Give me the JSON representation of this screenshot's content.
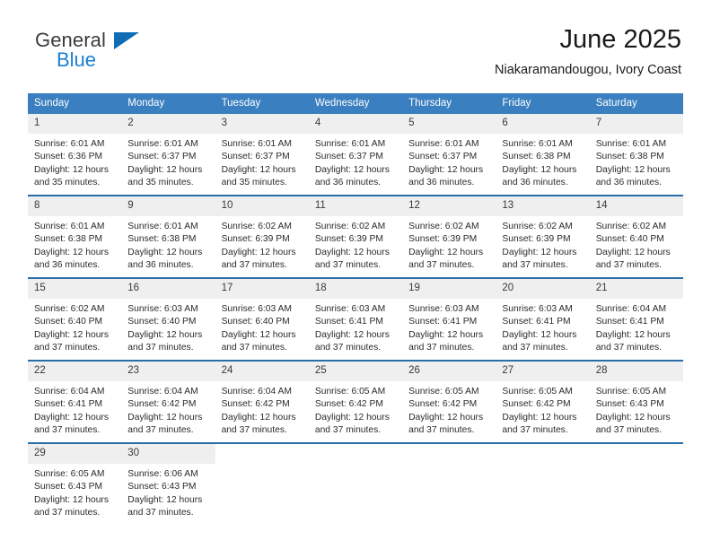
{
  "brand": {
    "name_part1": "General",
    "name_part2": "Blue",
    "triangle_color": "#0f6cb5",
    "blue_text_color": "#1a7fd4"
  },
  "header": {
    "title": "June 2025",
    "subtitle": "Niakaramandougou, Ivory Coast"
  },
  "theme": {
    "header_row_bg": "#3a7fbf",
    "header_row_text": "#ffffff",
    "row_divider": "#2a6da8",
    "daynum_bg": "#efefef"
  },
  "weekdays": [
    "Sunday",
    "Monday",
    "Tuesday",
    "Wednesday",
    "Thursday",
    "Friday",
    "Saturday"
  ],
  "weeks": [
    [
      {
        "day": "1",
        "sunrise": "Sunrise: 6:01 AM",
        "sunset": "Sunset: 6:36 PM",
        "daylight": "Daylight: 12 hours and 35 minutes."
      },
      {
        "day": "2",
        "sunrise": "Sunrise: 6:01 AM",
        "sunset": "Sunset: 6:37 PM",
        "daylight": "Daylight: 12 hours and 35 minutes."
      },
      {
        "day": "3",
        "sunrise": "Sunrise: 6:01 AM",
        "sunset": "Sunset: 6:37 PM",
        "daylight": "Daylight: 12 hours and 35 minutes."
      },
      {
        "day": "4",
        "sunrise": "Sunrise: 6:01 AM",
        "sunset": "Sunset: 6:37 PM",
        "daylight": "Daylight: 12 hours and 36 minutes."
      },
      {
        "day": "5",
        "sunrise": "Sunrise: 6:01 AM",
        "sunset": "Sunset: 6:37 PM",
        "daylight": "Daylight: 12 hours and 36 minutes."
      },
      {
        "day": "6",
        "sunrise": "Sunrise: 6:01 AM",
        "sunset": "Sunset: 6:38 PM",
        "daylight": "Daylight: 12 hours and 36 minutes."
      },
      {
        "day": "7",
        "sunrise": "Sunrise: 6:01 AM",
        "sunset": "Sunset: 6:38 PM",
        "daylight": "Daylight: 12 hours and 36 minutes."
      }
    ],
    [
      {
        "day": "8",
        "sunrise": "Sunrise: 6:01 AM",
        "sunset": "Sunset: 6:38 PM",
        "daylight": "Daylight: 12 hours and 36 minutes."
      },
      {
        "day": "9",
        "sunrise": "Sunrise: 6:01 AM",
        "sunset": "Sunset: 6:38 PM",
        "daylight": "Daylight: 12 hours and 36 minutes."
      },
      {
        "day": "10",
        "sunrise": "Sunrise: 6:02 AM",
        "sunset": "Sunset: 6:39 PM",
        "daylight": "Daylight: 12 hours and 37 minutes."
      },
      {
        "day": "11",
        "sunrise": "Sunrise: 6:02 AM",
        "sunset": "Sunset: 6:39 PM",
        "daylight": "Daylight: 12 hours and 37 minutes."
      },
      {
        "day": "12",
        "sunrise": "Sunrise: 6:02 AM",
        "sunset": "Sunset: 6:39 PM",
        "daylight": "Daylight: 12 hours and 37 minutes."
      },
      {
        "day": "13",
        "sunrise": "Sunrise: 6:02 AM",
        "sunset": "Sunset: 6:39 PM",
        "daylight": "Daylight: 12 hours and 37 minutes."
      },
      {
        "day": "14",
        "sunrise": "Sunrise: 6:02 AM",
        "sunset": "Sunset: 6:40 PM",
        "daylight": "Daylight: 12 hours and 37 minutes."
      }
    ],
    [
      {
        "day": "15",
        "sunrise": "Sunrise: 6:02 AM",
        "sunset": "Sunset: 6:40 PM",
        "daylight": "Daylight: 12 hours and 37 minutes."
      },
      {
        "day": "16",
        "sunrise": "Sunrise: 6:03 AM",
        "sunset": "Sunset: 6:40 PM",
        "daylight": "Daylight: 12 hours and 37 minutes."
      },
      {
        "day": "17",
        "sunrise": "Sunrise: 6:03 AM",
        "sunset": "Sunset: 6:40 PM",
        "daylight": "Daylight: 12 hours and 37 minutes."
      },
      {
        "day": "18",
        "sunrise": "Sunrise: 6:03 AM",
        "sunset": "Sunset: 6:41 PM",
        "daylight": "Daylight: 12 hours and 37 minutes."
      },
      {
        "day": "19",
        "sunrise": "Sunrise: 6:03 AM",
        "sunset": "Sunset: 6:41 PM",
        "daylight": "Daylight: 12 hours and 37 minutes."
      },
      {
        "day": "20",
        "sunrise": "Sunrise: 6:03 AM",
        "sunset": "Sunset: 6:41 PM",
        "daylight": "Daylight: 12 hours and 37 minutes."
      },
      {
        "day": "21",
        "sunrise": "Sunrise: 6:04 AM",
        "sunset": "Sunset: 6:41 PM",
        "daylight": "Daylight: 12 hours and 37 minutes."
      }
    ],
    [
      {
        "day": "22",
        "sunrise": "Sunrise: 6:04 AM",
        "sunset": "Sunset: 6:41 PM",
        "daylight": "Daylight: 12 hours and 37 minutes."
      },
      {
        "day": "23",
        "sunrise": "Sunrise: 6:04 AM",
        "sunset": "Sunset: 6:42 PM",
        "daylight": "Daylight: 12 hours and 37 minutes."
      },
      {
        "day": "24",
        "sunrise": "Sunrise: 6:04 AM",
        "sunset": "Sunset: 6:42 PM",
        "daylight": "Daylight: 12 hours and 37 minutes."
      },
      {
        "day": "25",
        "sunrise": "Sunrise: 6:05 AM",
        "sunset": "Sunset: 6:42 PM",
        "daylight": "Daylight: 12 hours and 37 minutes."
      },
      {
        "day": "26",
        "sunrise": "Sunrise: 6:05 AM",
        "sunset": "Sunset: 6:42 PM",
        "daylight": "Daylight: 12 hours and 37 minutes."
      },
      {
        "day": "27",
        "sunrise": "Sunrise: 6:05 AM",
        "sunset": "Sunset: 6:42 PM",
        "daylight": "Daylight: 12 hours and 37 minutes."
      },
      {
        "day": "28",
        "sunrise": "Sunrise: 6:05 AM",
        "sunset": "Sunset: 6:43 PM",
        "daylight": "Daylight: 12 hours and 37 minutes."
      }
    ],
    [
      {
        "day": "29",
        "sunrise": "Sunrise: 6:05 AM",
        "sunset": "Sunset: 6:43 PM",
        "daylight": "Daylight: 12 hours and 37 minutes."
      },
      {
        "day": "30",
        "sunrise": "Sunrise: 6:06 AM",
        "sunset": "Sunset: 6:43 PM",
        "daylight": "Daylight: 12 hours and 37 minutes."
      },
      {
        "day": "",
        "sunrise": "",
        "sunset": "",
        "daylight": ""
      },
      {
        "day": "",
        "sunrise": "",
        "sunset": "",
        "daylight": ""
      },
      {
        "day": "",
        "sunrise": "",
        "sunset": "",
        "daylight": ""
      },
      {
        "day": "",
        "sunrise": "",
        "sunset": "",
        "daylight": ""
      },
      {
        "day": "",
        "sunrise": "",
        "sunset": "",
        "daylight": ""
      }
    ]
  ]
}
